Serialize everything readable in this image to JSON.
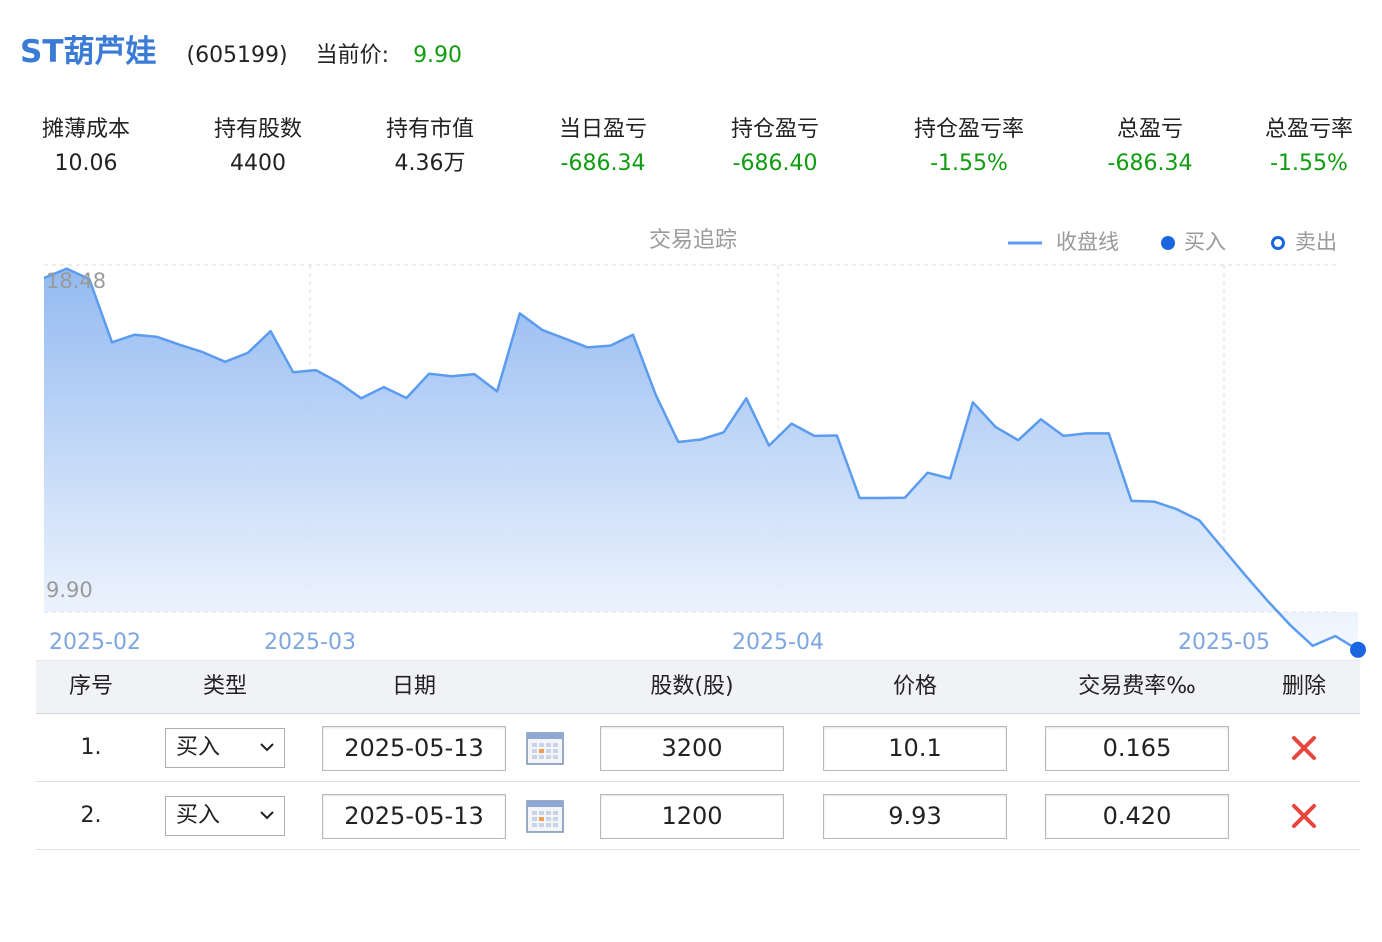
{
  "header": {
    "stock_name": "ST葫芦娃",
    "stock_code": "(605199)",
    "price_label": "当前价:",
    "price_value": "9.90"
  },
  "stats": [
    {
      "label": "摊薄成本",
      "value": "10.06",
      "status": "neutral"
    },
    {
      "label": "持有股数",
      "value": "4400",
      "status": "neutral"
    },
    {
      "label": "持有市值",
      "value": "4.36万",
      "status": "neutral"
    },
    {
      "label": "当日盈亏",
      "value": "-686.34",
      "status": "loss"
    },
    {
      "label": "持仓盈亏",
      "value": "-686.40",
      "status": "loss"
    },
    {
      "label": "持仓盈亏率",
      "value": "-1.55%",
      "status": "loss"
    },
    {
      "label": "总盈亏",
      "value": "-686.34",
      "status": "loss"
    },
    {
      "label": "总盈亏率",
      "value": "-1.55%",
      "status": "loss"
    }
  ],
  "chart_data": {
    "type": "area",
    "title": "交易追踪",
    "legend": [
      {
        "name": "收盘线",
        "marker": "line"
      },
      {
        "name": "买入",
        "marker": "filled-circle"
      },
      {
        "name": "卖出",
        "marker": "hollow-circle"
      }
    ],
    "legend_position": "top-right",
    "x_tick_labels": [
      "2025-02",
      "2025-03",
      "2025-04",
      "2025-05"
    ],
    "y_tick_labels": [
      "18.48",
      "9.90"
    ],
    "ylim": [
      9.9,
      18.48
    ],
    "series": [
      {
        "name": "收盘线",
        "values": [
          18.48,
          18.74,
          18.45,
          16.7,
          16.91,
          16.85,
          16.63,
          16.43,
          16.16,
          16.41,
          17.01,
          15.87,
          15.93,
          15.59,
          15.15,
          15.46,
          15.16,
          15.83,
          15.76,
          15.82,
          15.34,
          17.5,
          17.04,
          16.8,
          16.56,
          16.61,
          16.91,
          15.25,
          13.94,
          14.01,
          14.21,
          15.15,
          13.84,
          14.45,
          14.11,
          14.12,
          12.39,
          12.39,
          12.4,
          13.09,
          12.93,
          15.04,
          14.36,
          13.99,
          14.57,
          14.11,
          14.18,
          14.18,
          12.31,
          12.29,
          12.08,
          11.77,
          11.02,
          10.27,
          9.55,
          8.88,
          8.3,
          8.57,
          8.19
        ]
      }
    ],
    "trades": [
      {
        "type": "买入",
        "index": 58,
        "value": 8.19
      }
    ],
    "grid": true,
    "colors": {
      "line": "#5b9cf0",
      "fill_top": "#8db6f0",
      "fill_bottom": "#f4f8fe",
      "buy": "#1a66e0",
      "sell": "#1a66e0"
    }
  },
  "table": {
    "headers": {
      "index": "序号",
      "type": "类型",
      "date": "日期",
      "shares": "股数(股)",
      "price": "价格",
      "fee": "交易费率‰",
      "delete": "删除"
    },
    "rows": [
      {
        "index": "1.",
        "type": "买入",
        "date": "2025-05-13",
        "shares": "3200",
        "price": "10.1",
        "fee": "0.165"
      },
      {
        "index": "2.",
        "type": "买入",
        "date": "2025-05-13",
        "shares": "1200",
        "price": "9.93",
        "fee": "0.420"
      }
    ]
  }
}
